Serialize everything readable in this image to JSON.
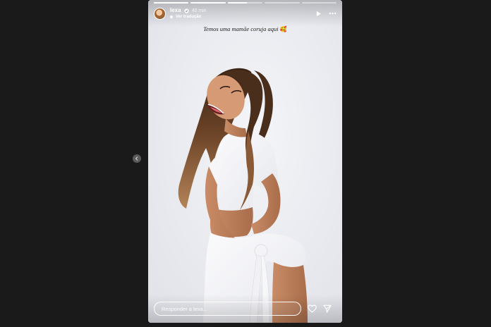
{
  "story": {
    "progress": [
      1,
      1,
      0.55,
      0,
      0
    ],
    "header": {
      "username": "lexa",
      "time": "40 min",
      "translate": "Ver tradução"
    },
    "caption": {
      "text": "Temos uma mamãe coruja aqui",
      "emoji": "🥰"
    },
    "reply": {
      "placeholder": "Responder a lexa..."
    }
  },
  "icons": {
    "verified": "verified-badge-icon",
    "play": "play-icon",
    "more": "more-options-icon",
    "like": "heart-icon",
    "share": "send-icon",
    "prev": "chevron-left-icon"
  }
}
